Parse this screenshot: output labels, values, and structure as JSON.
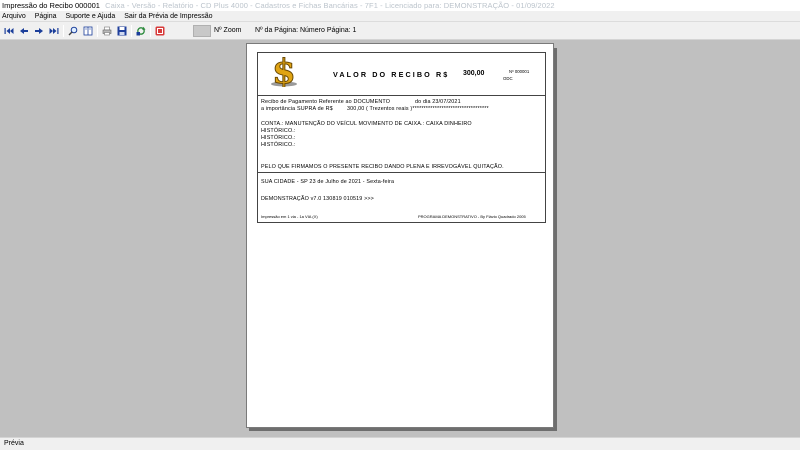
{
  "window": {
    "title": "Impressão do Recibo 000001",
    "title_obscured": "Caixa - Versão - Relatório - CD Plus 4000 - Cadastros e Fichas Bancárias - 7F1 - Licenciado para: DEMONSTRAÇÃO - 01/09/2022"
  },
  "menu": {
    "items": [
      "Arquivo",
      "Página",
      "Suporte e Ajuda",
      "Sair da Prévia de Impressão"
    ]
  },
  "toolbar": {
    "icons": [
      "first-page-icon",
      "previous-page-icon",
      "next-page-icon",
      "last-page-icon",
      "zoom-icon",
      "book-icon",
      "print-icon",
      "save-icon",
      "refresh-icon",
      "close-red-icon"
    ],
    "zoom_label": "Nº Zoom",
    "page_info": "Nº da Página: Número Página: 1"
  },
  "receipt": {
    "title": "VALOR DO RECIBO R$",
    "amount": "300,00",
    "number": "Nº 000001",
    "odc": "ODC",
    "line1": "Recibo de Pagamento Referente ao DOCUMENTO",
    "line1_date": "do dia 23/07/2021",
    "line2_prefix": "a importância SUPRA de R$",
    "line2_value": "300,00 ( Trezentos reais )**********************************",
    "conta": "CONTA.: MANUTENÇÃO DO VEÍCUL MOVIMENTO DE CAIXA.: CAIXA DINHEIRO",
    "historico1": "HISTÓRICO.:",
    "historico2": "HISTÓRICO.:",
    "historico3": "HISTÓRICO.:",
    "declaration": "PELO QUE FIRMAMOS O PRESENTE RECIBO DANDO PLENA E IRREVOGÁVEL QUITAÇÃO.",
    "city_date": "SUA CIDADE - SP 23 de Julho de 2021 - Sexta-feira",
    "version": "DEMONSTRAÇÃO v7.0 130819 010519 >>>",
    "footer_left": "Impressão em 1 via - 1a VIA (X)",
    "footer_right": "PROGRAMA DEMONSTRATIVO - By Flávio Quadrado 2005"
  },
  "status": {
    "text": "Prévia"
  },
  "colors": {
    "toolbar_icon": "#1b3e9a",
    "dollar_gold": "#d4a21a",
    "close_red": "#d83a3a"
  }
}
